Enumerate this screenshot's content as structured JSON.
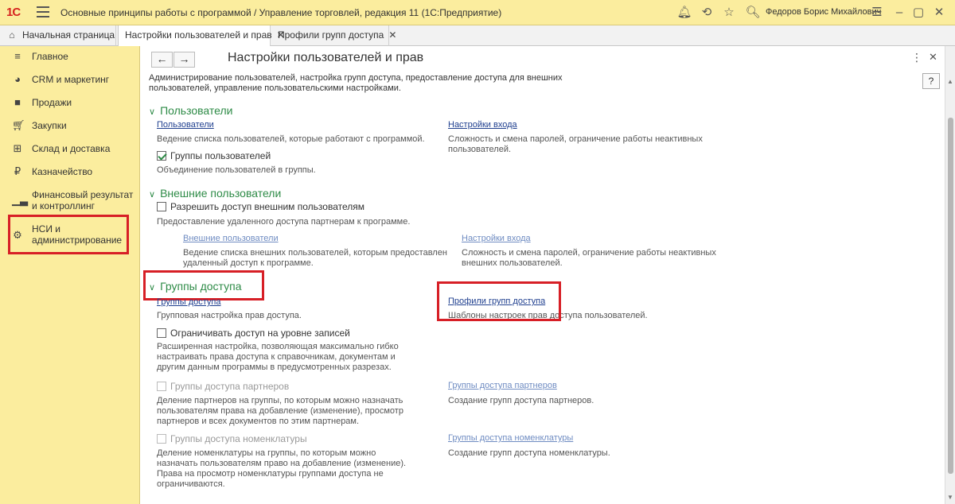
{
  "window": {
    "logo": "1С",
    "title": "Основные принципы работы с программой / Управление торговлей, редакция 11  (1С:Предприятие)",
    "user": "Федоров Борис Михайлович"
  },
  "tabs": {
    "home": "Начальная страница",
    "items": [
      {
        "label": "Настройки пользователей и прав"
      },
      {
        "label": "Профили групп доступа"
      }
    ]
  },
  "sidebar": {
    "items": [
      {
        "label": "Главное",
        "icon": "menu-lines-icon"
      },
      {
        "label": "CRM и маркетинг",
        "icon": "pie-chart-icon"
      },
      {
        "label": "Продажи",
        "icon": "bag-icon"
      },
      {
        "label": "Закупки",
        "icon": "cart-icon"
      },
      {
        "label": "Склад и доставка",
        "icon": "warehouse-grid-icon"
      },
      {
        "label": "Казначейство",
        "icon": "ruble-coin-icon"
      },
      {
        "label": "Финансовый результат и контроллинг",
        "icon": "bar-chart-icon"
      },
      {
        "label": "НСИ и администрирование",
        "icon": "gear-icon"
      }
    ]
  },
  "page": {
    "title": "Настройки пользователей и прав",
    "description": "Администрирование пользователей, настройка групп доступа, предоставление доступа для внешних пользователей, управление пользовательскими настройками.",
    "help": "?"
  },
  "users": {
    "header": "Пользователи",
    "users_link": "Пользователи",
    "users_note": "Ведение списка пользователей, которые работают с программой.",
    "login_link": "Настройки входа",
    "login_note": "Сложность и смена паролей, ограничение работы неактивных пользователей.",
    "groups_checkbox": "Группы пользователей",
    "groups_note": "Объединение пользователей в группы."
  },
  "external": {
    "header": "Внешние пользователи",
    "allow_checkbox": "Разрешить доступ внешним пользователям",
    "allow_note": "Предоставление удаленного доступа партнерам к программе.",
    "ext_link": "Внешние пользователи",
    "ext_note": "Ведение списка внешних пользователей, которым предоставлен удаленный доступ к программе.",
    "login_link": "Настройки входа",
    "login_note": "Сложность и смена паролей, ограничение работы неактивных внешних пользователей."
  },
  "access": {
    "header": "Группы доступа",
    "groups_link": "Группы доступа",
    "groups_note": "Групповая настройка прав доступа.",
    "profiles_link": "Профили групп доступа",
    "profiles_note": "Шаблоны настроек прав доступа пользователей.",
    "records_checkbox": "Ограничивать доступ на уровне записей",
    "records_note": "Расширенная настройка, позволяющая максимально гибко настраивать права доступа к справочникам, документам и другим данным программы в предусмотренных разрезах.",
    "partners_checkbox": "Группы доступа партнеров",
    "partners_note": "Деление партнеров на группы, по которым можно назначать пользователям права на добавление (изменение), просмотр партнеров и всех документов по этим партнерам.",
    "partners_link": "Группы доступа партнеров",
    "partners_link_note": "Создание групп доступа партнеров.",
    "nomen_checkbox": "Группы доступа номенклатуры",
    "nomen_note": "Деление номенклатуры на группы, по которым можно назначать пользователям право на добавление (изменение). Права на просмотр номенклатуры группами доступа не ограничиваются.",
    "nomen_link": "Группы доступа номенклатуры",
    "nomen_link_note": "Создание групп доступа номенклатуры."
  },
  "colors": {
    "accent_yellow": "#fbed9e",
    "section_green": "#2e8b47",
    "link_blue": "#1f3f8f",
    "highlight_red": "#d71f26"
  }
}
